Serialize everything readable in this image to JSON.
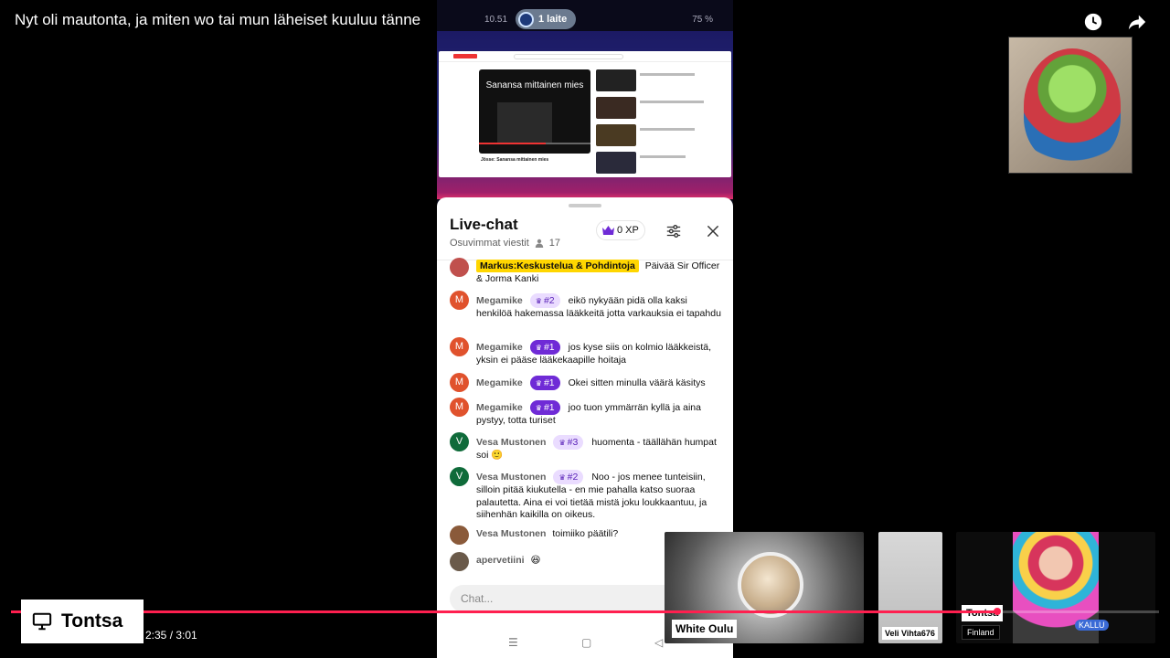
{
  "video": {
    "title": "Nyt oli mautonta, ja miten wo tai mun läheiset kuuluu tänne",
    "time": "2:35 / 3:01",
    "progress_fraction": 0.859
  },
  "phone": {
    "status_time": "10.51",
    "device_label": "1 laite",
    "battery": "75 %",
    "mini_player_title": "Sanansa mittainen mies",
    "mini_caption": "Jösse: Sanansa mittainen mies"
  },
  "chat": {
    "title": "Live-chat",
    "subtitle": "Osuvimmat viestit",
    "viewers": "17",
    "xp": "0 XP",
    "input_placeholder": "Chat...",
    "messages": [
      {
        "author": "Markus:Keskustelua & Pohdintoja",
        "owner": true,
        "rank": "",
        "text": "Päivää Sir Officer & Jorma Kanki",
        "avatar_letter": "",
        "avatar_color": "#c0504d"
      },
      {
        "author": "Megamike",
        "owner": false,
        "rank": "#2",
        "text": "eikö nykyään pidä olla kaksi henkilöä hakemassa lääkkeitä jotta varkauksia ei tapahdu",
        "avatar_letter": "M",
        "avatar_color": "#e0522d"
      },
      {
        "author": "Megamike",
        "owner": false,
        "rank": "#1",
        "text": "jos kyse siis on kolmio lääkkeistä, yksin ei pääse lääkekaapille hoitaja",
        "avatar_letter": "M",
        "avatar_color": "#e0522d"
      },
      {
        "author": "Megamike",
        "owner": false,
        "rank": "#1",
        "text": "Okei sitten minulla väärä käsitys",
        "avatar_letter": "M",
        "avatar_color": "#e0522d"
      },
      {
        "author": "Megamike",
        "owner": false,
        "rank": "#1",
        "text": "joo tuon ymmärrän kyllä ja aina pystyy, totta turiset",
        "avatar_letter": "M",
        "avatar_color": "#e0522d"
      },
      {
        "author": "Vesa Mustonen",
        "owner": false,
        "rank": "#3",
        "text": "huomenta - täällähän humpat soi 🙂",
        "avatar_letter": "V",
        "avatar_color": "#0f6b3a"
      },
      {
        "author": "Vesa Mustonen",
        "owner": false,
        "rank": "#2",
        "text": "Noo - jos menee tunteisiin, silloin pitää kiukutella - en mie pahalla katso suoraa palautetta. Aina ei voi tietää mistä joku loukkaantuu, ja siihenhän kaikilla on oikeus.",
        "avatar_letter": "V",
        "avatar_color": "#0f6b3a"
      },
      {
        "author": "Vesa Mustonen",
        "owner": false,
        "rank": "",
        "text": "toimiiko päätili?",
        "avatar_letter": "",
        "avatar_color": "#8a5a3a"
      },
      {
        "author": "apervetiini",
        "owner": false,
        "rank": "",
        "text": "😆",
        "avatar_letter": "",
        "avatar_color": "#6a5a4a"
      }
    ]
  },
  "participants": {
    "white_oulu": "White Oulu",
    "veli": "Veli Vihta676",
    "tontsa": "Tontsa",
    "tontsa_country": "Finland",
    "tontsa_overlay": "KALLU"
  },
  "channel": {
    "name": "Tontsa"
  },
  "colors": {
    "accent": "#ff1f4f",
    "rank_primary": "#6f2bd6",
    "owner_highlight": "#ffd600"
  }
}
